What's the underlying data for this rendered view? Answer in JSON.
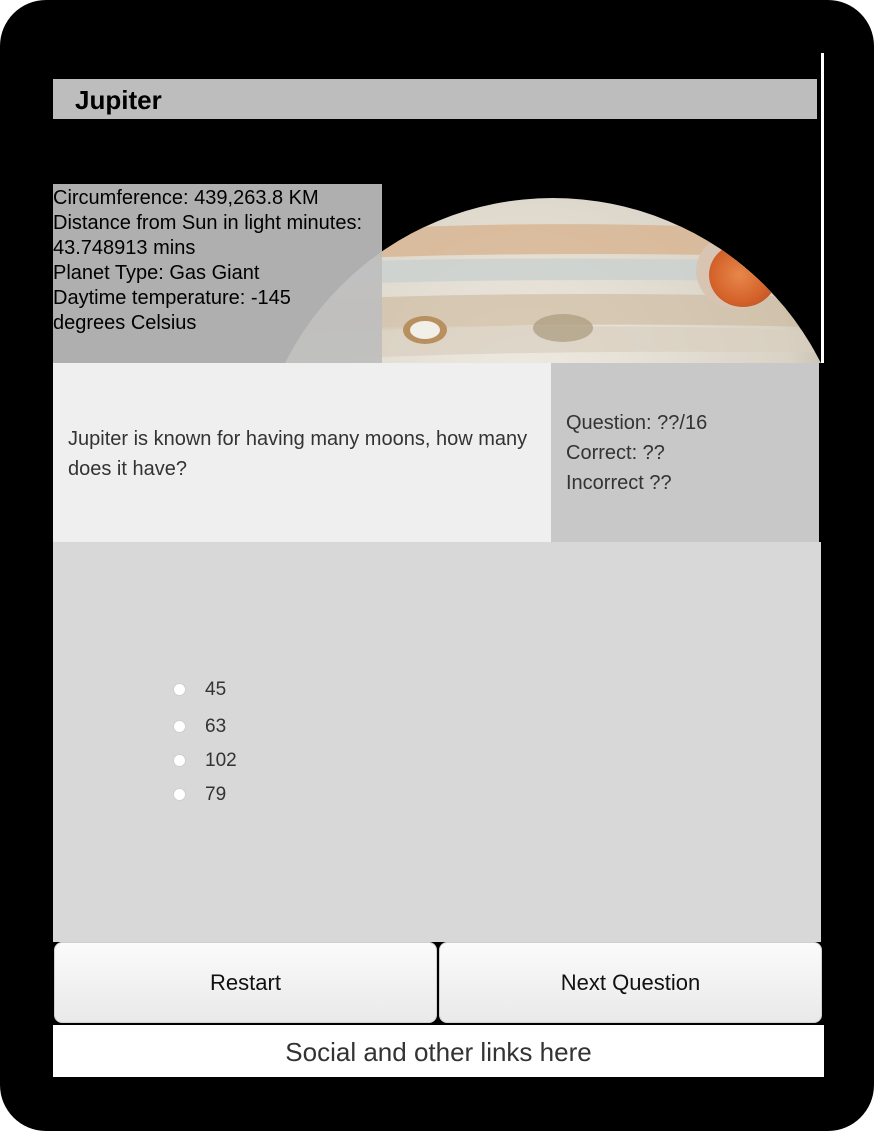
{
  "planet": {
    "name": "Jupiter",
    "info": [
      "Circumference: 439,263.8 KM",
      "Distance from Sun in light minutes:",
      "43.748913 mins",
      "Planet Type: Gas Giant",
      "Daytime temperature: -145",
      "degrees Celsius"
    ]
  },
  "quiz": {
    "question": "Jupiter is known for having many moons, how many does it have?",
    "score": {
      "question": "Question: ??/16",
      "correct": "Correct: ??",
      "incorrect": "Incorrect ??"
    },
    "options": [
      "45",
      "63",
      "102",
      "79"
    ]
  },
  "buttons": {
    "restart": "Restart",
    "next": "Next Question"
  },
  "footer": {
    "text": "Social and other links here"
  },
  "colors": {
    "title_bar": "#bdbdbd",
    "question_bg": "#efefef",
    "score_bg": "#c8c8c8",
    "answers_bg": "#d8d8d8",
    "great_red_spot": "#d9652c"
  }
}
